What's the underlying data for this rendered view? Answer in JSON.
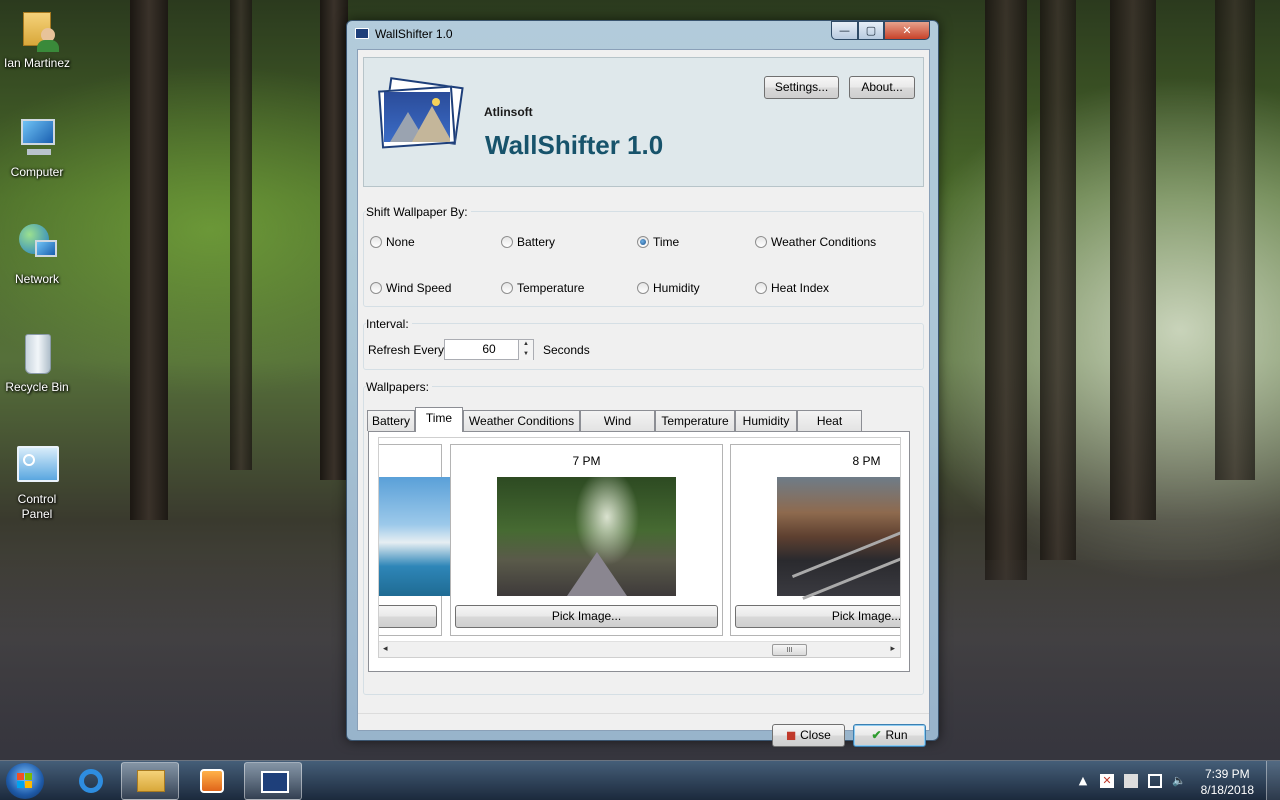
{
  "desktop": {
    "icons": [
      {
        "name": "user-folder",
        "label": "Ian Martinez"
      },
      {
        "name": "computer",
        "label": "Computer"
      },
      {
        "name": "network",
        "label": "Network"
      },
      {
        "name": "recycle-bin",
        "label": "Recycle Bin"
      },
      {
        "name": "control-panel",
        "label_line1": "Control",
        "label_line2": "Panel"
      }
    ]
  },
  "window": {
    "title": "WallShifter 1.0",
    "controls": {
      "minimize": "—",
      "maximize": "▢",
      "close": "✕"
    }
  },
  "header": {
    "company": "Atlinsoft",
    "app_title": "WallShifter 1.0",
    "settings_label": "Settings...",
    "about_label": "About..."
  },
  "shift_by": {
    "label": "Shift Wallpaper By:",
    "selected": "Time",
    "options": [
      "None",
      "Battery",
      "Time",
      "Weather Conditions",
      "Wind Speed",
      "Temperature",
      "Humidity",
      "Heat Index"
    ]
  },
  "interval": {
    "label": "Interval:",
    "refresh_label": "Refresh Every",
    "value": "60",
    "unit": "Seconds"
  },
  "wallpapers": {
    "label": "Wallpapers:",
    "tabs": [
      "Battery",
      "Time",
      "Weather Conditions",
      "Wind Speed",
      "Temperature",
      "Humidity",
      "Heat Index"
    ],
    "active_tab": "Time",
    "cards": [
      {
        "time": "7 PM",
        "button": "Pick Image..."
      },
      {
        "time": "8 PM",
        "button": "Pick Image..."
      }
    ],
    "scroll_grip": "III"
  },
  "footer": {
    "close_label": "Close",
    "run_label": "Run"
  },
  "taskbar": {
    "clock_time": "7:39 PM",
    "clock_date": "8/18/2018",
    "tray_arrow": "▲"
  },
  "colors": {
    "title_accent": "#17536b",
    "header_bg": "#dfe8eb",
    "run_check": "#2e9b2e",
    "close_icon": "#c0392b"
  }
}
